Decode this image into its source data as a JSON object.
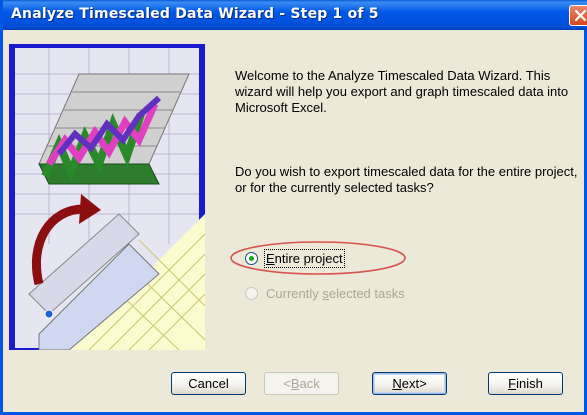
{
  "window": {
    "title": "Analyze Timescaled Data Wizard - Step 1 of 5"
  },
  "body": {
    "welcome_text": "Welcome to the Analyze Timescaled Data Wizard. This wizard will help you export and graph timescaled data into Microsoft Excel.",
    "question_text": "Do you wish to export timescaled data for the entire project, or for the currently selected tasks?"
  },
  "options": [
    {
      "label_pre": "",
      "label_key": "E",
      "label_post": "ntire project",
      "selected": true,
      "enabled": true
    },
    {
      "label_pre": "Currently ",
      "label_key": "s",
      "label_post": "elected tasks",
      "selected": false,
      "enabled": false
    }
  ],
  "buttons": {
    "cancel": {
      "label": "Cancel"
    },
    "back": {
      "label_key": "B",
      "label_post": "ack",
      "prefix": "< "
    },
    "next": {
      "label_key": "N",
      "label_post": "ext",
      "suffix": " >"
    },
    "finish": {
      "label_key": "F",
      "label_post": "inish"
    }
  },
  "colors": {
    "title_bar": "#0058e6",
    "dialog_bg": "#ece9d8",
    "highlight_ellipse": "#d9534f"
  },
  "icons": {
    "close": "close-icon",
    "illustration": "spreadsheet-chart-illustration"
  }
}
